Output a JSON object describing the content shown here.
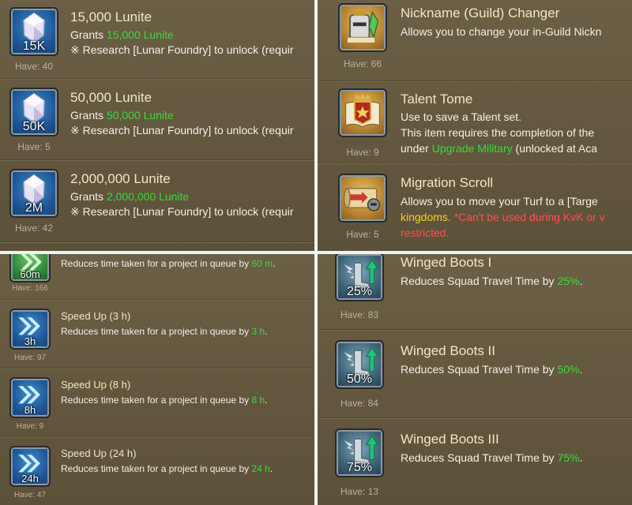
{
  "panels": {
    "lunite": {
      "items": [
        {
          "title": "15,000 Lunite",
          "grants_prefix": "Grants ",
          "grants_value": "15,000 Lunite",
          "note": "※ Research [Lunar Foundry] to unlock (requir",
          "amount": "15K",
          "have": "Have: 40",
          "icon": "crystal-icon"
        },
        {
          "title": "50,000 Lunite",
          "grants_prefix": "Grants ",
          "grants_value": "50,000 Lunite",
          "note": "※ Research [Lunar Foundry] to unlock (requir",
          "amount": "50K",
          "have": "Have: 5",
          "icon": "crystal-icon"
        },
        {
          "title": "2,000,000 Lunite",
          "grants_prefix": "Grants ",
          "grants_value": "2,000,000 Lunite",
          "note": "※ Research [Lunar Foundry] to unlock (requir",
          "amount": "2M",
          "have": "Have: 42",
          "icon": "crystal-icon"
        }
      ]
    },
    "misc": {
      "items": [
        {
          "title": "Nickname (Guild) Changer",
          "desc": "Allows you to change your in-Guild Nickn",
          "have": "Have: 66",
          "icon": "guild-helmet-icon"
        },
        {
          "title": "Talent Tome",
          "desc_line1": "Use to save a Talent set.",
          "desc_line2": "This item requires the completion of the",
          "desc_line3_prefix": "under ",
          "desc_line3_highlight": "Upgrade Military",
          "desc_line3_suffix": " (unlocked at Aca",
          "have": "Have: 9",
          "icon": "tome-icon"
        },
        {
          "title": "Migration Scroll",
          "desc_line1": "Allows you to move your Turf to a [Targe",
          "desc_line2_highlight": "kingdoms.",
          "desc_line2_warning": " *Can't be used during KvK or v",
          "desc_line3_warning": "restricted.",
          "have": "Have: 5",
          "icon": "scroll-icon"
        }
      ]
    },
    "speedups": {
      "partial": {
        "desc_prefix": "Reduces time taken for a project in queue by ",
        "desc_value": "60 m",
        "desc_suffix": ".",
        "amount": "60m",
        "have": "Have: 166"
      },
      "items": [
        {
          "title": "Speed Up (3 h)",
          "desc_prefix": "Reduces time taken for a project in queue by ",
          "desc_value": "3 h",
          "desc_suffix": ".",
          "amount": "3h",
          "have": "Have: 97",
          "icon": "double-arrow-icon"
        },
        {
          "title": "Speed Up (8 h)",
          "desc_prefix": "Reduces time taken for a project in queue by ",
          "desc_value": "8 h",
          "desc_suffix": ".",
          "amount": "8h",
          "have": "Have: 9",
          "icon": "double-arrow-icon"
        },
        {
          "title": "Speed Up (24 h)",
          "desc_prefix": "Reduces time taken for a project in queue by ",
          "desc_value": "24 h",
          "desc_suffix": ".",
          "amount": "24h",
          "have": "Have: 47",
          "icon": "double-arrow-icon"
        }
      ]
    },
    "boots": {
      "items": [
        {
          "title": "Winged Boots I",
          "desc_prefix": "Reduces Squad Travel Time by ",
          "desc_value": "25%",
          "desc_suffix": ".",
          "amount": "25%",
          "have": "Have: 83",
          "icon": "winged-boot-icon"
        },
        {
          "title": "Winged Boots II",
          "desc_prefix": "Reduces Squad Travel Time by ",
          "desc_value": "50%",
          "desc_suffix": ".",
          "amount": "50%",
          "have": "Have: 84",
          "icon": "winged-boot-icon"
        },
        {
          "title": "Winged Boots III",
          "desc_prefix": "Reduces Squad Travel Time by ",
          "desc_value": "75%",
          "desc_suffix": ".",
          "amount": "75%",
          "have": "Have: 13",
          "icon": "winged-boot-icon"
        }
      ]
    }
  },
  "colors": {
    "panel_bg": "#65593f",
    "title": "#f2e6c4",
    "highlight_green": "#39d93b",
    "highlight_yellow": "#f3d11d",
    "warning_red": "#ff4f4f"
  }
}
